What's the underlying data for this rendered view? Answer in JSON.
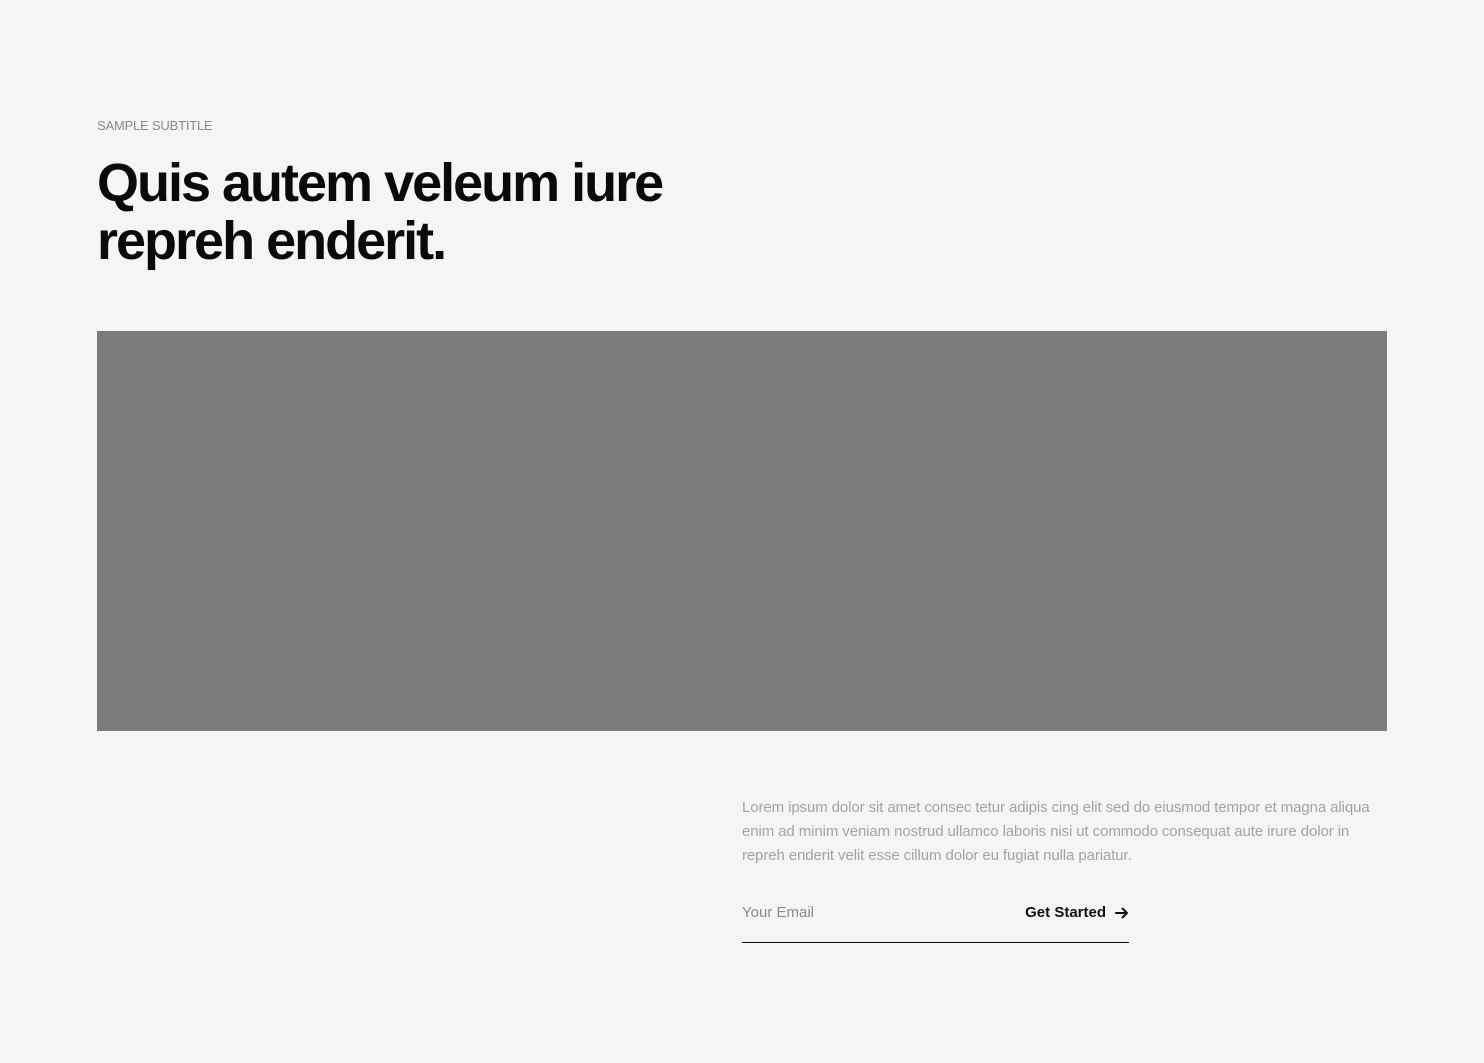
{
  "header": {
    "subtitle": "SAMPLE SUBTITLE",
    "headline": "Quis autem veleum iure repreh enderit."
  },
  "hero": {
    "image_color": "#7b7c7e"
  },
  "content": {
    "body": "Lorem ipsum dolor sit amet consec tetur adipis cing elit sed do eiusmod tempor et magna aliqua enim ad minim veniam nostrud ullamco laboris nisi ut commodo consequat aute irure dolor in repreh enderit velit esse cillum dolor eu fugiat nulla pariatur."
  },
  "signup": {
    "email_placeholder": "Your Email",
    "email_value": "",
    "cta_label": "Get Started",
    "cta_icon": "arrow-right-icon"
  }
}
